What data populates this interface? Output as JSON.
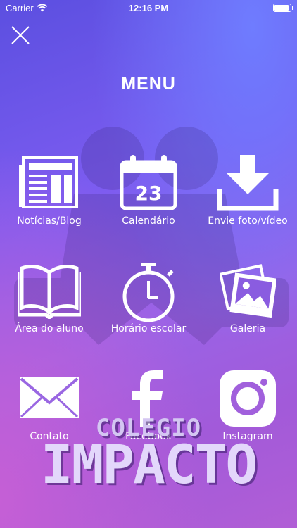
{
  "status_bar": {
    "carrier": "Carrier",
    "time": "12:16 PM"
  },
  "header": {
    "title": "MENU"
  },
  "menu": {
    "items": [
      {
        "label": "Notícias/Blog",
        "icon": "newspaper-icon"
      },
      {
        "label": "Calendário",
        "icon": "calendar-icon",
        "day": "23"
      },
      {
        "label": "Envie foto/vídeo",
        "icon": "download-icon"
      },
      {
        "label": "Área do aluno",
        "icon": "book-icon"
      },
      {
        "label": "Horário escolar",
        "icon": "stopwatch-icon"
      },
      {
        "label": "Galeria",
        "icon": "photos-icon"
      },
      {
        "label": "Contato",
        "icon": "envelope-icon"
      },
      {
        "label": "Facebook",
        "icon": "facebook-icon"
      },
      {
        "label": "Instagram",
        "icon": "instagram-icon"
      }
    ]
  },
  "brand": {
    "line1": "COLEGIO",
    "line2": "IMPACTO"
  },
  "colors": {
    "background_start": "#5b4fe0",
    "background_end": "#b15ed6",
    "text": "#ffffff"
  }
}
